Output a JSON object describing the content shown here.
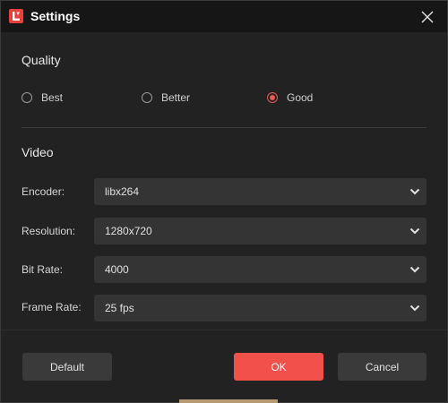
{
  "window": {
    "title": "Settings"
  },
  "icons": {
    "app": "app-logo-icon",
    "close": "close-icon",
    "dropdown": "chevron-down-icon"
  },
  "colors": {
    "accent": "#f2504a",
    "window_bg": "#222222",
    "titlebar_bg": "#161616",
    "control_bg": "#343434"
  },
  "quality": {
    "heading": "Quality",
    "options": [
      {
        "label": "Best",
        "selected": false
      },
      {
        "label": "Better",
        "selected": false
      },
      {
        "label": "Good",
        "selected": true
      }
    ]
  },
  "video": {
    "heading": "Video",
    "fields": [
      {
        "label": "Encoder:",
        "value": "libx264"
      },
      {
        "label": "Resolution:",
        "value": "1280x720"
      },
      {
        "label": "Bit Rate:",
        "value": "4000"
      },
      {
        "label": "Frame Rate:",
        "value": "25 fps"
      }
    ]
  },
  "buttons": {
    "default_label": "Default",
    "ok_label": "OK",
    "cancel_label": "Cancel"
  }
}
